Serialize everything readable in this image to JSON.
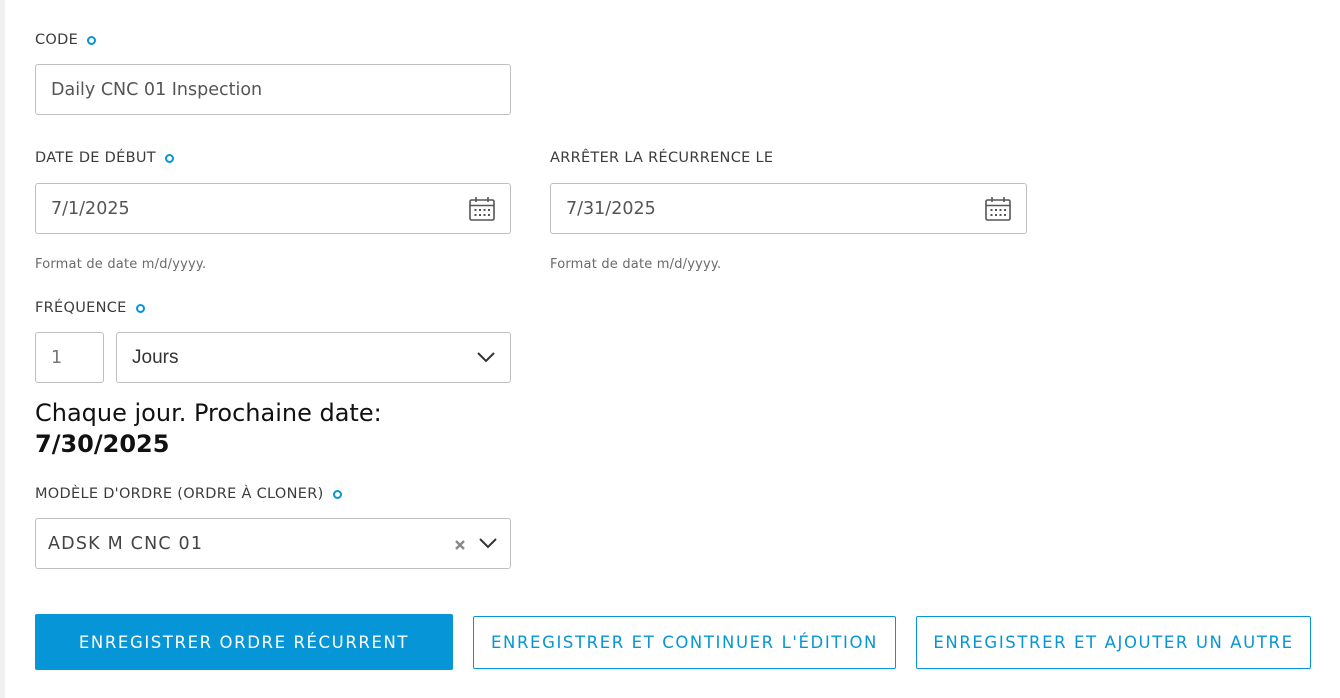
{
  "form": {
    "code": {
      "label": "CODE",
      "value": "Daily CNC 01 Inspection"
    },
    "start_date": {
      "label": "DATE DE DÉBUT",
      "value": "7/1/2025",
      "hint": "Format de date m/d/yyyy.",
      "icon": "calendar-icon"
    },
    "stop_date": {
      "label": "ARRÊTER LA RÉCURRENCE LE",
      "value": "7/31/2025",
      "hint": "Format de date m/d/yyyy.",
      "icon": "calendar-icon"
    },
    "frequency": {
      "label": "FRÉQUENCE",
      "count": "1",
      "unit": "Jours",
      "icon": "chevron-down-icon"
    },
    "summary": {
      "text": "Chaque jour. Prochaine date:",
      "next_date": "7/30/2025"
    },
    "template": {
      "label": "MODÈLE D'ORDRE (ORDRE À CLONER)",
      "value": "ADSK M CNC 01",
      "clear_icon": "close-icon",
      "dropdown_icon": "chevron-down-icon"
    }
  },
  "actions": {
    "save_recurring": "ENREGISTRER ORDRE RÉCURRENT",
    "save_continue": "ENREGISTRER ET CONTINUER L'ÉDITION",
    "save_add_another": "ENREGISTRER ET AJOUTER UN AUTRE"
  },
  "colors": {
    "accent": "#0696d7",
    "border": "#bfbfbf",
    "text": "#3c3c3c"
  }
}
